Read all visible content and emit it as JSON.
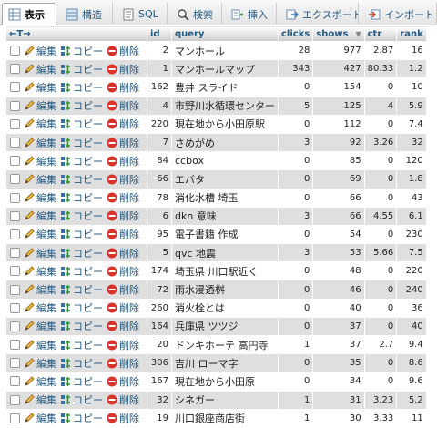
{
  "tabs": [
    {
      "label": "表示",
      "icon": "browse-icon"
    },
    {
      "label": "構造",
      "icon": "structure-icon"
    },
    {
      "label": "SQL",
      "icon": "sql-icon"
    },
    {
      "label": "検索",
      "icon": "search-icon"
    },
    {
      "label": "挿入",
      "icon": "insert-icon"
    },
    {
      "label": "エクスポート",
      "icon": "export-icon"
    },
    {
      "label": "インポート",
      "icon": "import-icon"
    }
  ],
  "header": {
    "nav": "←T→",
    "columns": [
      "id",
      "query",
      "clicks",
      "shows",
      "ctr",
      "rank"
    ],
    "sort_indicator": "▼"
  },
  "actions": {
    "edit": "編集",
    "copy": "コピー",
    "delete": "削除"
  },
  "rows": [
    {
      "id": "2",
      "query": "マンホール",
      "clicks": "28",
      "shows": "977",
      "ctr": "2.87",
      "rank": "16"
    },
    {
      "id": "1",
      "query": "マンホールマップ",
      "clicks": "343",
      "shows": "427",
      "ctr": "80.33",
      "rank": "1.2"
    },
    {
      "id": "162",
      "query": "豊井 スライド",
      "clicks": "0",
      "shows": "154",
      "ctr": "0",
      "rank": "10"
    },
    {
      "id": "4",
      "query": "市野川水循環センター",
      "clicks": "5",
      "shows": "125",
      "ctr": "4",
      "rank": "5.9"
    },
    {
      "id": "220",
      "query": "現在地から小田原駅",
      "clicks": "0",
      "shows": "112",
      "ctr": "0",
      "rank": "7.4"
    },
    {
      "id": "7",
      "query": "さめがめ",
      "clicks": "3",
      "shows": "92",
      "ctr": "3.26",
      "rank": "32"
    },
    {
      "id": "84",
      "query": "ccbox",
      "clicks": "0",
      "shows": "85",
      "ctr": "0",
      "rank": "120"
    },
    {
      "id": "66",
      "query": "エバタ",
      "clicks": "0",
      "shows": "69",
      "ctr": "0",
      "rank": "1.8"
    },
    {
      "id": "78",
      "query": "消化水槽 埼玉",
      "clicks": "0",
      "shows": "66",
      "ctr": "0",
      "rank": "43"
    },
    {
      "id": "6",
      "query": "dkn 意味",
      "clicks": "3",
      "shows": "66",
      "ctr": "4.55",
      "rank": "6.1"
    },
    {
      "id": "95",
      "query": "電子書籍 作成",
      "clicks": "0",
      "shows": "54",
      "ctr": "0",
      "rank": "230"
    },
    {
      "id": "5",
      "query": "qvc 地震",
      "clicks": "3",
      "shows": "53",
      "ctr": "5.66",
      "rank": "7.5"
    },
    {
      "id": "174",
      "query": "埼玉県 川口駅近く",
      "clicks": "0",
      "shows": "48",
      "ctr": "0",
      "rank": "220"
    },
    {
      "id": "72",
      "query": "雨水浸透桝",
      "clicks": "0",
      "shows": "46",
      "ctr": "0",
      "rank": "240"
    },
    {
      "id": "260",
      "query": "消火栓とは",
      "clicks": "0",
      "shows": "40",
      "ctr": "0",
      "rank": "36"
    },
    {
      "id": "164",
      "query": "兵庫県 ツツジ",
      "clicks": "0",
      "shows": "37",
      "ctr": "0",
      "rank": "40"
    },
    {
      "id": "20",
      "query": "ドンキホーテ 高円寺",
      "clicks": "1",
      "shows": "37",
      "ctr": "2.7",
      "rank": "9.4"
    },
    {
      "id": "306",
      "query": "吉川 ローマ字",
      "clicks": "0",
      "shows": "35",
      "ctr": "0",
      "rank": "8.6"
    },
    {
      "id": "167",
      "query": "現在地から小田原",
      "clicks": "0",
      "shows": "34",
      "ctr": "0",
      "rank": "9.6"
    },
    {
      "id": "32",
      "query": "シネガー",
      "clicks": "1",
      "shows": "31",
      "ctr": "3.23",
      "rank": "5.2"
    },
    {
      "id": "19",
      "query": "川口銀座商店街",
      "clicks": "1",
      "shows": "30",
      "ctr": "3.33",
      "rank": "11"
    }
  ]
}
